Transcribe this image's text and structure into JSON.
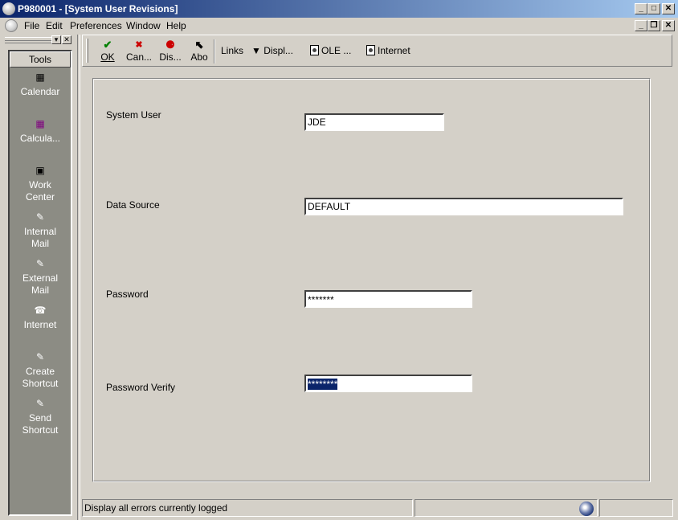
{
  "window": {
    "title": "P980001 - [System User Revisions]",
    "controls": {
      "minimize": "_",
      "maximize": "□",
      "close": "✕"
    }
  },
  "doc_controls": {
    "minimize": "_",
    "restore": "❐",
    "close": "✕"
  },
  "menubar": {
    "items": [
      "File",
      "Edit",
      "Preferences",
      "Window",
      "Help"
    ]
  },
  "tools": {
    "header": "Tools",
    "items": [
      {
        "label": "Calendar",
        "icon": "calendar-icon",
        "glyph": "▦"
      },
      {
        "label": "Calcula...",
        "icon": "calculator-icon",
        "glyph": "▦"
      },
      {
        "label": "Work Center",
        "icon": "work-center-icon",
        "glyph": "▣"
      },
      {
        "label": "Internal Mail",
        "icon": "internal-mail-icon",
        "glyph": "✎"
      },
      {
        "label": "External Mail",
        "icon": "external-mail-icon",
        "glyph": "✎"
      },
      {
        "label": "Internet",
        "icon": "internet-phone-icon",
        "glyph": "☎"
      },
      {
        "label": "Create Shortcut",
        "icon": "create-shortcut-icon",
        "glyph": "✎"
      },
      {
        "label": "Send Shortcut",
        "icon": "send-shortcut-icon",
        "glyph": "✎"
      }
    ]
  },
  "toolbar": {
    "ok_label": "OK",
    "cancel_label": "Can...",
    "display_label": "Dis...",
    "about_label": "Abo",
    "links_label": "Links",
    "display_menu_label": "Displ...",
    "ole_label": "OLE ...",
    "internet_label": "Internet",
    "icons": {
      "ok": "✔",
      "cancel": "✖",
      "display": "⚈",
      "about": "⬉",
      "dropdown": "▼"
    },
    "colors": {
      "ok": "#008000",
      "cancel": "#cc0000"
    }
  },
  "form": {
    "system_user_label": "System User",
    "system_user_value": "JDE",
    "data_source_label": "Data Source",
    "data_source_value": "DEFAULT",
    "password_label": "Password",
    "password_value": "*******",
    "password_verify_label": "Password Verify",
    "password_verify_value": "********"
  },
  "statusbar": {
    "message": "Display all errors currently logged"
  }
}
